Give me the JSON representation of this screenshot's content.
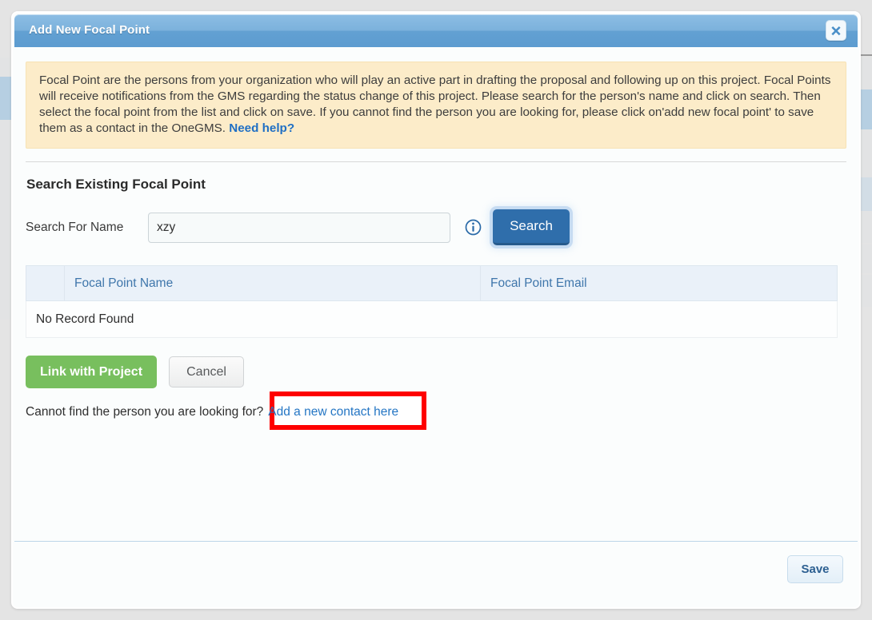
{
  "modal": {
    "title": "Add New Focal Point",
    "close_icon": "close-icon",
    "notice": {
      "text": "Focal Point are the persons from your organization who will play an active part in drafting the proposal and following up on this project. Focal Points will receive notifications from the GMS regarding the status change of this project. Please search for the person's name and click on search. Then select the focal point from the list and click on save. If you cannot find the person you are looking for, please click on'add new focal point' to save them as a contact in the OneGMS.",
      "help_link": "Need help?"
    },
    "section_title": "Search Existing Focal Point",
    "search": {
      "label": "Search For Name",
      "value": "xzy",
      "placeholder": "",
      "info_icon": "info-icon",
      "button_label": "Search"
    },
    "table": {
      "columns": [
        "",
        "Focal Point Name",
        "Focal Point Email"
      ],
      "empty_message": "No Record Found"
    },
    "actions": {
      "link_label": "Link with Project",
      "cancel_label": "Cancel"
    },
    "hint": {
      "text": "Cannot find the person you are looking for?",
      "link_label": "Add a new contact here"
    },
    "footer": {
      "save_label": "Save"
    }
  },
  "colors": {
    "header_blue": "#7cb2dc",
    "notice_bg": "#fcecc9",
    "link_blue": "#2576c4",
    "search_button": "#2f6eab",
    "link_project_green": "#78bf5e",
    "annotation_red": "#fe0000",
    "table_header_bg": "#eaf1f9"
  }
}
